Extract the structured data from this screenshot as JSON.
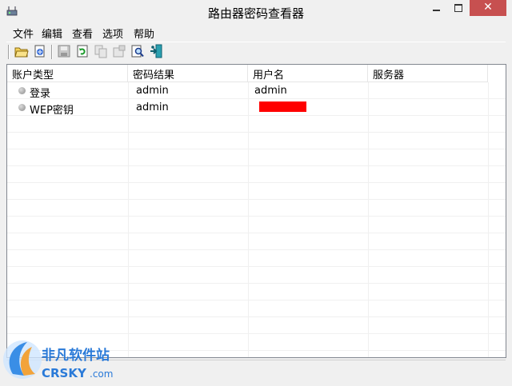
{
  "window": {
    "title": "路由器密码查看器",
    "close_glyph": "✕"
  },
  "menu": [
    "文件",
    "编辑",
    "查看",
    "选项",
    "帮助"
  ],
  "toolbar_icons": [
    "open-icon",
    "export-icon",
    "save-icon",
    "refresh-icon",
    "copy-icon",
    "properties-icon",
    "find-icon",
    "exit-icon"
  ],
  "columns": [
    "账户类型",
    "密码结果",
    "用户名",
    "服务器"
  ],
  "rows": [
    {
      "type": "登录",
      "password": "admin",
      "username": "admin",
      "server": ""
    },
    {
      "type": "WEP密钥",
      "password": "admin",
      "username": "",
      "server": "",
      "username_redacted": true
    }
  ],
  "watermark": {
    "brand": "非凡软件站",
    "sub": "CRSKY",
    "tld": ".com"
  },
  "colors": {
    "close_button": "#c75050",
    "redaction": "#ff0000",
    "list_border": "#828790"
  }
}
